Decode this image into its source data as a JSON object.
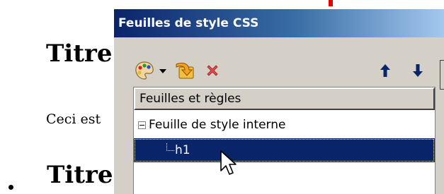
{
  "document": {
    "heading1": "Titre",
    "paragraph": "Ceci est",
    "heading2": "Titre"
  },
  "dialog": {
    "title": "Feuilles de style CSS",
    "toolbar": {
      "new_icon": "palette-icon",
      "dropdown_icon": "chevron-down-icon",
      "import_icon": "import-arrow-icon",
      "delete_icon": "delete-x-icon",
      "up_icon": "arrow-up-icon",
      "down_icon": "arrow-down-icon"
    },
    "tree": {
      "column_header": "Feuilles et règles",
      "items": [
        {
          "label": "Feuille de style interne",
          "expanded": true
        },
        {
          "label": "h1",
          "selected": true
        }
      ]
    }
  },
  "colors": {
    "title_start": "#0a246a",
    "title_end": "#a6caf0",
    "selection": "#0a246a",
    "dialog_face": "#d4d0c8",
    "marker_red": "#e00000"
  }
}
